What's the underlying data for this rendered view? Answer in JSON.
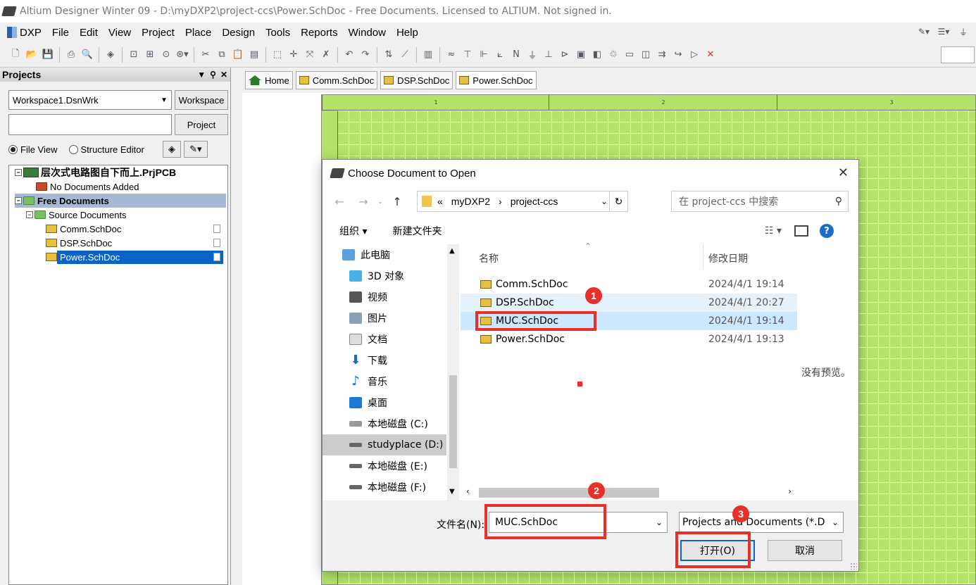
{
  "window": {
    "title": "Altium Designer Winter 09 - D:\\myDXP2\\project-ccs\\Power.SchDoc - Free Documents. Licensed to ALTIUM. Not signed in."
  },
  "menu": [
    "DXP",
    "File",
    "Edit",
    "View",
    "Project",
    "Place",
    "Design",
    "Tools",
    "Reports",
    "Window",
    "Help"
  ],
  "projects_panel": {
    "title": "Projects",
    "workspace_value": "Workspace1.DsnWrk",
    "workspace_button": "Workspace",
    "project_button": "Project",
    "file_view_label": "File View",
    "structure_editor_label": "Structure Editor",
    "tree": {
      "pcb_project": "层次式电路图自下而上.PrjPCB",
      "no_docs": "No Documents Added",
      "free_docs": "Free Documents",
      "source_docs": "Source Documents",
      "files": [
        "Comm.SchDoc",
        "DSP.SchDoc",
        "Power.SchDoc"
      ]
    }
  },
  "doc_tabs": [
    "Home",
    "Comm.SchDoc",
    "DSP.SchDoc",
    "Power.SchDoc"
  ],
  "ruler": [
    "1",
    "2",
    "3"
  ],
  "dialog": {
    "title": "Choose Document to Open",
    "path": [
      "«",
      "myDXP2",
      "›",
      "project-ccs"
    ],
    "search_placeholder": "在 project-ccs 中搜索",
    "organize": "组织 ▾",
    "new_folder": "新建文件夹",
    "nav": [
      "此电脑",
      "3D 对象",
      "视频",
      "图片",
      "文档",
      "下载",
      "音乐",
      "桌面",
      "本地磁盘 (C:)",
      "studyplace (D:)",
      "本地磁盘 (E:)",
      "本地磁盘 (F:)"
    ],
    "col_name": "名称",
    "col_date": "修改日期",
    "files": [
      {
        "name": "Comm.SchDoc",
        "date": "2024/4/1 19:14"
      },
      {
        "name": "DSP.SchDoc",
        "date": "2024/4/1 20:27"
      },
      {
        "name": "MUC.SchDoc",
        "date": "2024/4/1 19:14"
      },
      {
        "name": "Power.SchDoc",
        "date": "2024/4/1 19:13"
      }
    ],
    "no_preview": "没有预览。",
    "filename_label": "文件名(N):",
    "filename_value": "MUC.SchDoc",
    "filetype": "Projects and Documents (*.D",
    "open_button": "打开(O)",
    "cancel_button": "取消"
  },
  "annotations": [
    "1",
    "2",
    "3"
  ],
  "colors": {
    "accent": "#0a64c8",
    "highlight": "#e8302a",
    "sheet": "#b3e36a"
  }
}
